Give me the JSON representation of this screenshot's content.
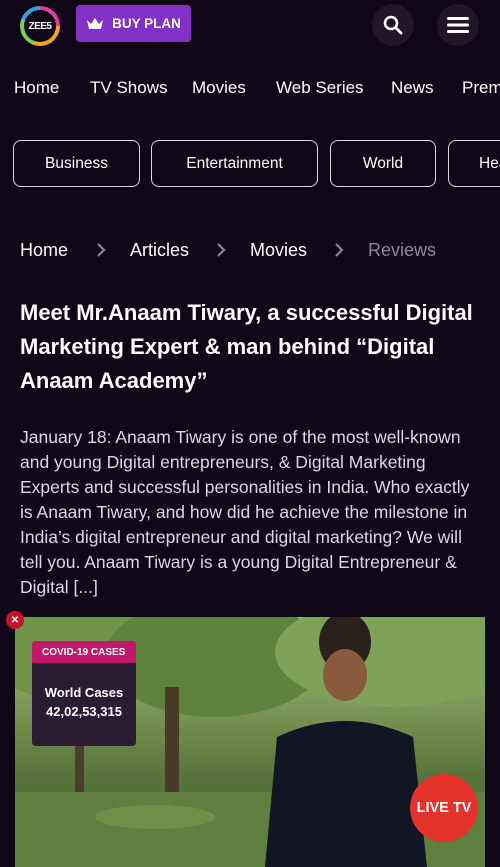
{
  "header": {
    "logo_text": "ZEE5",
    "buy_plan_label": "BUY PLAN"
  },
  "nav": {
    "items": [
      "Home",
      "TV Shows",
      "Movies",
      "Web Series",
      "News",
      "Premium"
    ]
  },
  "categories": {
    "items": [
      "Business",
      "Entertainment",
      "World",
      "Health"
    ]
  },
  "breadcrumb": {
    "items": [
      "Home",
      "Articles",
      "Movies",
      "Reviews"
    ]
  },
  "article": {
    "title": "Meet Mr.Anaam Tiwary, a successful Digital Marketing Expert & man behind “Digital Anaam Academy”",
    "excerpt": "January 18: Anaam Tiwary is one of the most well-known and young Digital entrepreneurs, & Digital Marketing Experts and successful personalities in India.  Who exactly is Anaam Tiwary, and how did he achieve the milestone in India’s digital entrepreneur and digital marketing? We will tell you. Anaam Tiwary is a young Digital Entrepreneur & Digital [...]"
  },
  "covid_widget": {
    "header": "COVID-19 CASES",
    "label": "World Cases",
    "value": "42,02,53,315"
  },
  "live_tv": {
    "label": "LIVE TV"
  },
  "icons": [
    "crown-icon",
    "search-icon",
    "menu-icon",
    "chevron-right-icon",
    "close-icon"
  ],
  "colors": {
    "background": "#0f0617",
    "accent_purple": "#8230c6",
    "live_red": "#e5322b",
    "covid_pink": "#c2186a"
  }
}
